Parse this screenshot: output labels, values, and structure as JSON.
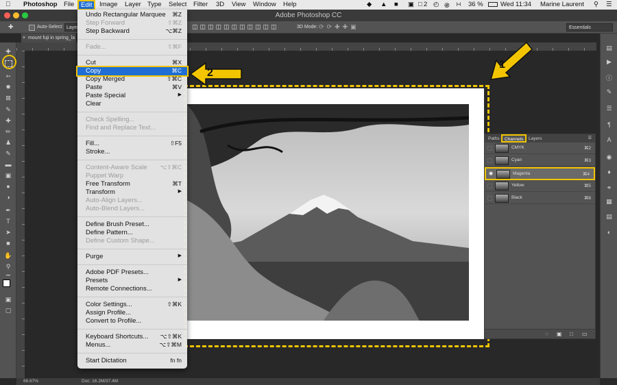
{
  "menubar": {
    "app": "Photoshop",
    "items": [
      "File",
      "Edit",
      "Image",
      "Layer",
      "Type",
      "Select",
      "Filter",
      "3D",
      "View",
      "Window",
      "Help"
    ],
    "battery": "36 %",
    "time": "Wed 11:34",
    "user": "Marine Laurent",
    "badge": "2"
  },
  "window": {
    "title": "Adobe Photoshop CC"
  },
  "options": {
    "auto_select": "Auto-Select:",
    "auto_select_value": "Layer",
    "mode_3d": "3D Mode:",
    "workspace": "Essentials"
  },
  "document": {
    "tab": "mount fuji in spring_la"
  },
  "edit_menu": {
    "items": [
      {
        "label": "Undo Rectangular Marquee",
        "shortcut": "⌘Z",
        "disabled": false
      },
      {
        "label": "Step Forward",
        "shortcut": "⇧⌘Z",
        "disabled": true
      },
      {
        "label": "Step Backward",
        "shortcut": "⌥⌘Z",
        "disabled": false
      },
      {
        "sep": true
      },
      {
        "label": "Fade...",
        "shortcut": "⇧⌘F",
        "disabled": true
      },
      {
        "sep": true
      },
      {
        "label": "Cut",
        "shortcut": "⌘X",
        "disabled": false
      },
      {
        "label": "Copy",
        "shortcut": "⌘C",
        "disabled": false,
        "active": true
      },
      {
        "label": "Copy Merged",
        "shortcut": "⇧⌘C",
        "disabled": false
      },
      {
        "label": "Paste",
        "shortcut": "⌘V",
        "disabled": false
      },
      {
        "label": "Paste Special",
        "submenu": true,
        "disabled": false
      },
      {
        "label": "Clear",
        "disabled": false
      },
      {
        "sep": true
      },
      {
        "label": "Check Spelling...",
        "disabled": true
      },
      {
        "label": "Find and Replace Text...",
        "disabled": true
      },
      {
        "sep": true
      },
      {
        "label": "Fill...",
        "shortcut": "⇧F5",
        "disabled": false
      },
      {
        "label": "Stroke...",
        "disabled": false
      },
      {
        "sep": true
      },
      {
        "label": "Content-Aware Scale",
        "shortcut": "⌥⇧⌘C",
        "disabled": true
      },
      {
        "label": "Puppet Warp",
        "disabled": true
      },
      {
        "label": "Free Transform",
        "shortcut": "⌘T",
        "disabled": false
      },
      {
        "label": "Transform",
        "submenu": true,
        "disabled": false
      },
      {
        "label": "Auto-Align Layers...",
        "disabled": true
      },
      {
        "label": "Auto-Blend Layers...",
        "disabled": true
      },
      {
        "sep": true
      },
      {
        "label": "Define Brush Preset...",
        "disabled": false
      },
      {
        "label": "Define Pattern...",
        "disabled": false
      },
      {
        "label": "Define Custom Shape...",
        "disabled": true
      },
      {
        "sep": true
      },
      {
        "label": "Purge",
        "submenu": true,
        "disabled": false
      },
      {
        "sep": true
      },
      {
        "label": "Adobe PDF Presets...",
        "disabled": false
      },
      {
        "label": "Presets",
        "submenu": true,
        "disabled": false
      },
      {
        "label": "Remote Connections...",
        "disabled": false
      },
      {
        "sep": true
      },
      {
        "label": "Color Settings...",
        "shortcut": "⇧⌘K",
        "disabled": false
      },
      {
        "label": "Assign Profile...",
        "disabled": false
      },
      {
        "label": "Convert to Profile...",
        "disabled": false
      },
      {
        "sep": true
      },
      {
        "label": "Keyboard Shortcuts...",
        "shortcut": "⌥⇧⌘K",
        "disabled": false
      },
      {
        "label": "Menus...",
        "shortcut": "⌥⇧⌘M",
        "disabled": false
      },
      {
        "sep": true
      },
      {
        "label": "Start Dictation",
        "shortcut": "fn fn",
        "disabled": false
      }
    ]
  },
  "channels_panel": {
    "tabs": [
      "Paths",
      "Channels",
      "Layers"
    ],
    "rows": [
      {
        "name": "CMYK",
        "shortcut": "⌘2",
        "visible": false
      },
      {
        "name": "Cyan",
        "shortcut": "⌘3",
        "visible": false
      },
      {
        "name": "Magenta",
        "shortcut": "⌘4",
        "visible": true,
        "selected": true
      },
      {
        "name": "Yellow",
        "shortcut": "⌘5",
        "visible": false
      },
      {
        "name": "Black",
        "shortcut": "⌘6",
        "visible": false
      }
    ]
  },
  "status": {
    "zoom": "66.67%",
    "doc": "Doc: 16.2M/37.4M"
  },
  "annotations": {
    "num1": "1",
    "num2": "2"
  },
  "colors": {
    "highlight": "#f2c500",
    "menu_active": "#1f6ed4"
  }
}
